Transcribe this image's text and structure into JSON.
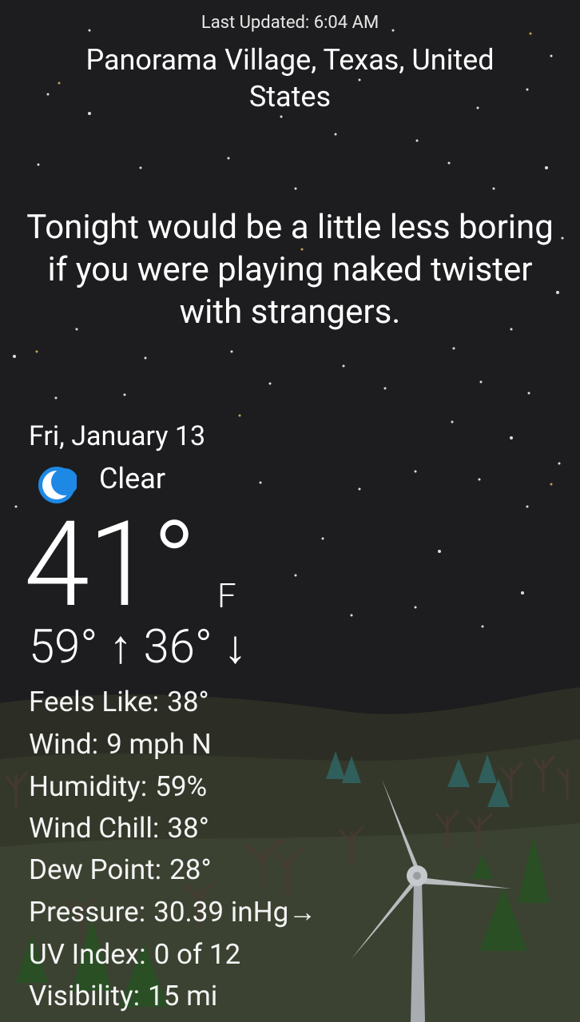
{
  "header": {
    "last_updated": "Last Updated: 6:04 AM",
    "location": "Panorama Village, Texas, United States"
  },
  "message": "Tonight would be a little less boring if you were playing naked twister with strangers.",
  "current": {
    "date": "Fri, January 13",
    "condition": "Clear",
    "condition_icon": "moon-icon",
    "temperature": "41°",
    "unit": "F",
    "high_low": "59° ↑ 36° ↓"
  },
  "stats": [
    {
      "label": "Feels Like:",
      "value": "38°"
    },
    {
      "label": "Wind:",
      "value": "9 mph N"
    },
    {
      "label": "Humidity:",
      "value": "59%"
    },
    {
      "label": "Wind Chill:",
      "value": "38°"
    },
    {
      "label": "Dew Point:",
      "value": "28°"
    },
    {
      "label": "Pressure:",
      "value": "30.39 inHg→"
    },
    {
      "label": "UV Index:",
      "value": "0 of 12"
    },
    {
      "label": "Visibility:",
      "value": "15 mi"
    }
  ],
  "colors": {
    "sky": "#1d1d1f",
    "hill": "#3a3d2a",
    "moon": "#1e88e5",
    "tree_dark": "#2e5a2a",
    "tree_bare": "#4a3a33"
  }
}
